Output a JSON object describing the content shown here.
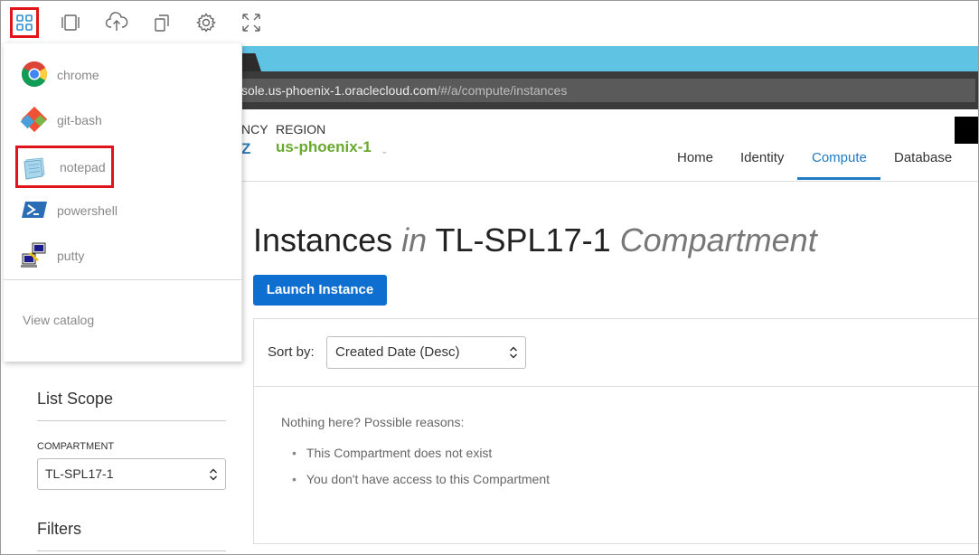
{
  "toolbar": {
    "buttons": [
      {
        "icon": "apps-grid-icon",
        "active": true
      },
      {
        "icon": "window-frame-icon"
      },
      {
        "icon": "cloud-upload-icon"
      },
      {
        "icon": "copy-icon"
      },
      {
        "icon": "gear-icon"
      },
      {
        "icon": "fullscreen-icon"
      }
    ]
  },
  "browser": {
    "url_host": "sole.us-phoenix-1.oraclecloud.com",
    "url_path": "/#/a/compute/instances"
  },
  "header": {
    "tenancy_label": "NCY",
    "tenancy_value": "Z",
    "region_label": "REGION",
    "region_value": "us-phoenix-1",
    "region_caret": "⌄",
    "nav": [
      "Home",
      "Identity",
      "Compute",
      "Database"
    ],
    "active_nav": "Compute"
  },
  "main": {
    "title_a": "Instances",
    "title_in": "in",
    "title_b": "TL-SPL17-1",
    "title_c": "Compartment",
    "launch_label": "Launch Instance",
    "sort_label": "Sort by:",
    "sort_value": "Created Date (Desc)",
    "empty_heading": "Nothing here? Possible reasons:",
    "reasons": [
      "This Compartment does not exist",
      "You don't have access to this Compartment"
    ]
  },
  "sidebar": {
    "scope_title": "List Scope",
    "compartment_label": "COMPARTMENT",
    "compartment_value": "TL-SPL17-1",
    "filters_title": "Filters"
  },
  "app_menu": {
    "items": [
      {
        "label": "chrome",
        "icon": "chrome-icon"
      },
      {
        "label": "git-bash",
        "icon": "git-bash-icon"
      },
      {
        "label": "notepad",
        "icon": "notepad-icon",
        "highlighted": true
      },
      {
        "label": "powershell",
        "icon": "powershell-icon"
      },
      {
        "label": "putty",
        "icon": "putty-icon"
      }
    ],
    "view_catalog": "View catalog"
  },
  "colors": {
    "accent_blue": "#1f7bc3",
    "launch_button": "#0f6fd1",
    "region_green": "#6aa92f",
    "highlight_red": "#e0141a",
    "top_bar_blue": "#5fc3e4"
  }
}
